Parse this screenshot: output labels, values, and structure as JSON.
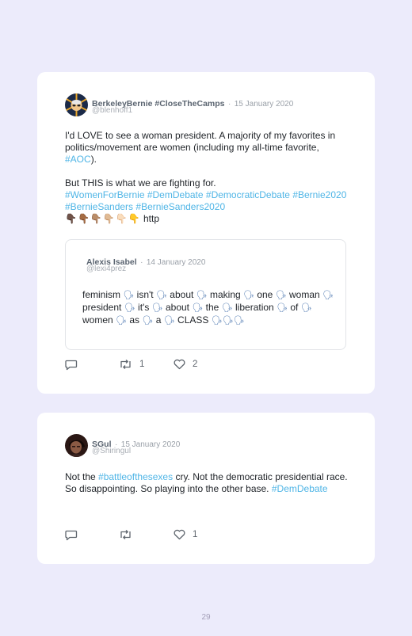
{
  "tweets": [
    {
      "author": {
        "name": "BerkeleyBernie #CloseTheCamps",
        "handle": "@blenhoff1",
        "date": "15 January 2020",
        "avatar": "avatar-bernie-sunburst"
      },
      "text": {
        "p1": "I'd LOVE to see a woman president. A majority of my favorites in politics/movement are women (including my all-time favorite, ",
        "p1_tag": "#AOC",
        "p1_end": ").",
        "p2": "But THIS is what we are fighting for.",
        "tags": [
          "#WomenForBernie",
          "#DemDebate",
          "#DemocraticDebate",
          "#Bernie2020",
          "#BernieSanders",
          "#BernieSanders2020"
        ],
        "hands": "👇🏿👇🏾👇🏽👇🏼👇🏻👇",
        "link": "http"
      },
      "quote": {
        "name": "Alexis Isabel",
        "date": "14 January 2020",
        "handle": "@lexi4prez",
        "words": [
          "feminism",
          "isn't",
          "about",
          "making",
          "one",
          "woman",
          "president",
          "it's",
          "about",
          "the",
          "liberation",
          "of",
          "women",
          "as",
          "a",
          "CLASS"
        ],
        "icon": "speaking-head-icon"
      },
      "actions": {
        "retweets": "1",
        "likes": "2"
      }
    },
    {
      "author": {
        "name": "SGul",
        "handle": "@Shiringul",
        "date": "15 January 2020",
        "avatar": "avatar-portrait-dark"
      },
      "text": {
        "p1": "Not the ",
        "p1_tag": "#battleofthesexes",
        "p1_mid": " cry. Not the democratic presidential race. So disappointing. So playing into the other base. ",
        "p1_tag2": "#DemDebate"
      },
      "actions": {
        "likes": "1"
      }
    }
  ],
  "page": {
    "number": "29"
  },
  "colors": {
    "background": "#ecebfb",
    "card": "#ffffff",
    "hashtag": "#4fb5e6",
    "meta": "#9aa0a8"
  },
  "separator": "·"
}
